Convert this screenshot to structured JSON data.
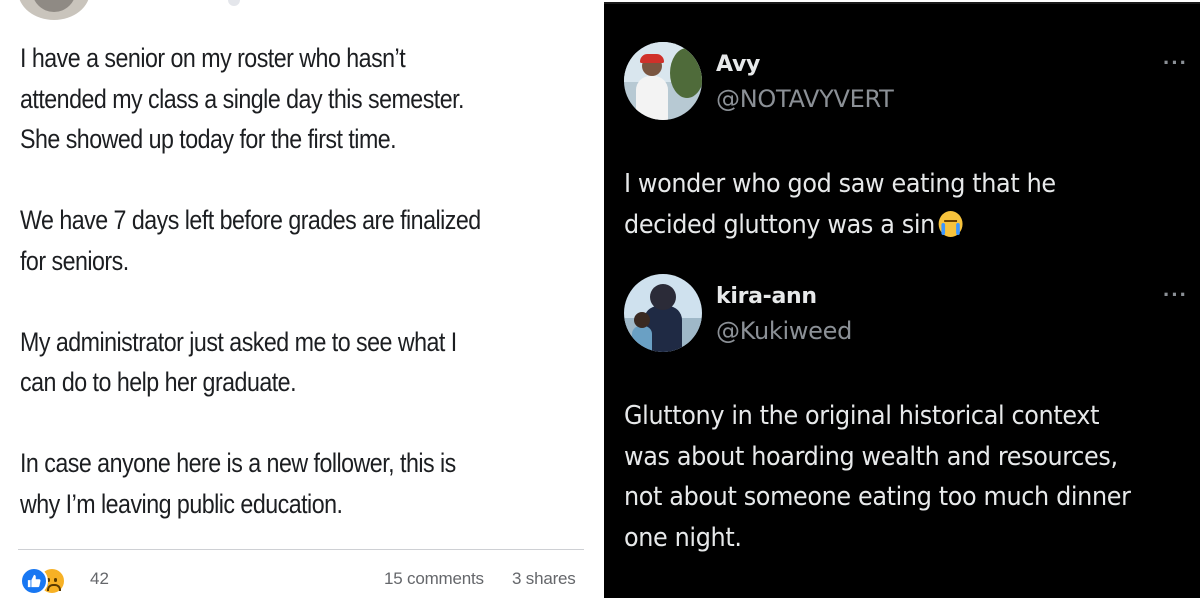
{
  "facebook_post": {
    "paragraphs": [
      "I have a senior on my roster who hasn’t\nattended my class a single day this semester.\nShe showed up today for the first time.",
      "We have 7 days left before grades are finalized\nfor seniors.",
      "My administrator just asked me to see what I\ncan do to help her graduate.",
      "In case anyone here is a new follower, this is\nwhy I’m leaving public education."
    ],
    "reactions": {
      "icons": [
        "like-icon",
        "sad-icon"
      ],
      "count": "42"
    },
    "comments": "15 comments",
    "shares": "3 shares"
  },
  "tweets": [
    {
      "name": "Avy",
      "handle": "@NOTAVYVERT",
      "more": "···",
      "text": "I wonder who god saw eating that he\ndecided gluttony was a sin",
      "emoji": "loudly-crying-face-icon"
    },
    {
      "name": "kira-ann",
      "handle": "@Kukiweed",
      "more": "···",
      "text": "Gluttony in the original historical context\nwas about hoarding wealth and resources,\nnot about someone eating too much dinner\none night."
    }
  ],
  "colors": {
    "fb_background": "#ffffff",
    "fb_text": "#1c1e21",
    "fb_meta": "#65676b",
    "like_blue": "#1877f2",
    "tw_background": "#000000",
    "tw_text": "#e7e9ea",
    "tw_handle": "#8b9096"
  }
}
